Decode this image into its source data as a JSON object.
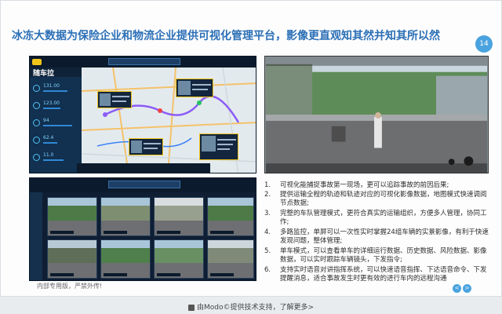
{
  "slide": {
    "title": "冰冻大数据为保险企业和物流企业提供可视化管理平台，影像更直观知其然并知其所以然",
    "page_number": "14",
    "internal_note": "内部专用版，严禁外传!"
  },
  "dashboard": {
    "brand": "随车拉",
    "stats": [
      "131.00",
      "123.00",
      "94",
      "62.4",
      "11.0"
    ],
    "stat_levels": [
      0.7,
      0.5,
      0.85,
      0.4,
      0.6
    ]
  },
  "list_items": [
    {
      "num": "1.",
      "text": "可视化能捕捉事故第一现场，更可以追踪事故的前因后果;"
    },
    {
      "num": "2.",
      "text": "提供运输全程的轨迹和轨迹对应的可视化影像数据，地图模式快速调阅节点数据;"
    },
    {
      "num": "3.",
      "text": "完整的车队管理模式，更符合真实的运输组织，方便多人管理，协同工作;"
    },
    {
      "num": "4.",
      "text": "多路监控，单屏可以一次性实时掌握24组车辆的实景影像，有利于快速发现问题，整体管理;"
    },
    {
      "num": "5.",
      "text": "单车模式，可以查看单车的详细运行数据、历史数据、风险数据、影像数据，可以实时跟踪车辆镜头，下发指令;"
    },
    {
      "num": "6.",
      "text": "支持实时语音对讲指挥系统，可以快速语音指挥、下达语音命令、下发提醒消息，适合事故发生时更有效的进行车内的远程沟通"
    }
  ],
  "nav": {
    "prev": "<",
    "next": ">"
  },
  "footer": {
    "text": "由Modo©提供技术支持，了解更多>"
  }
}
